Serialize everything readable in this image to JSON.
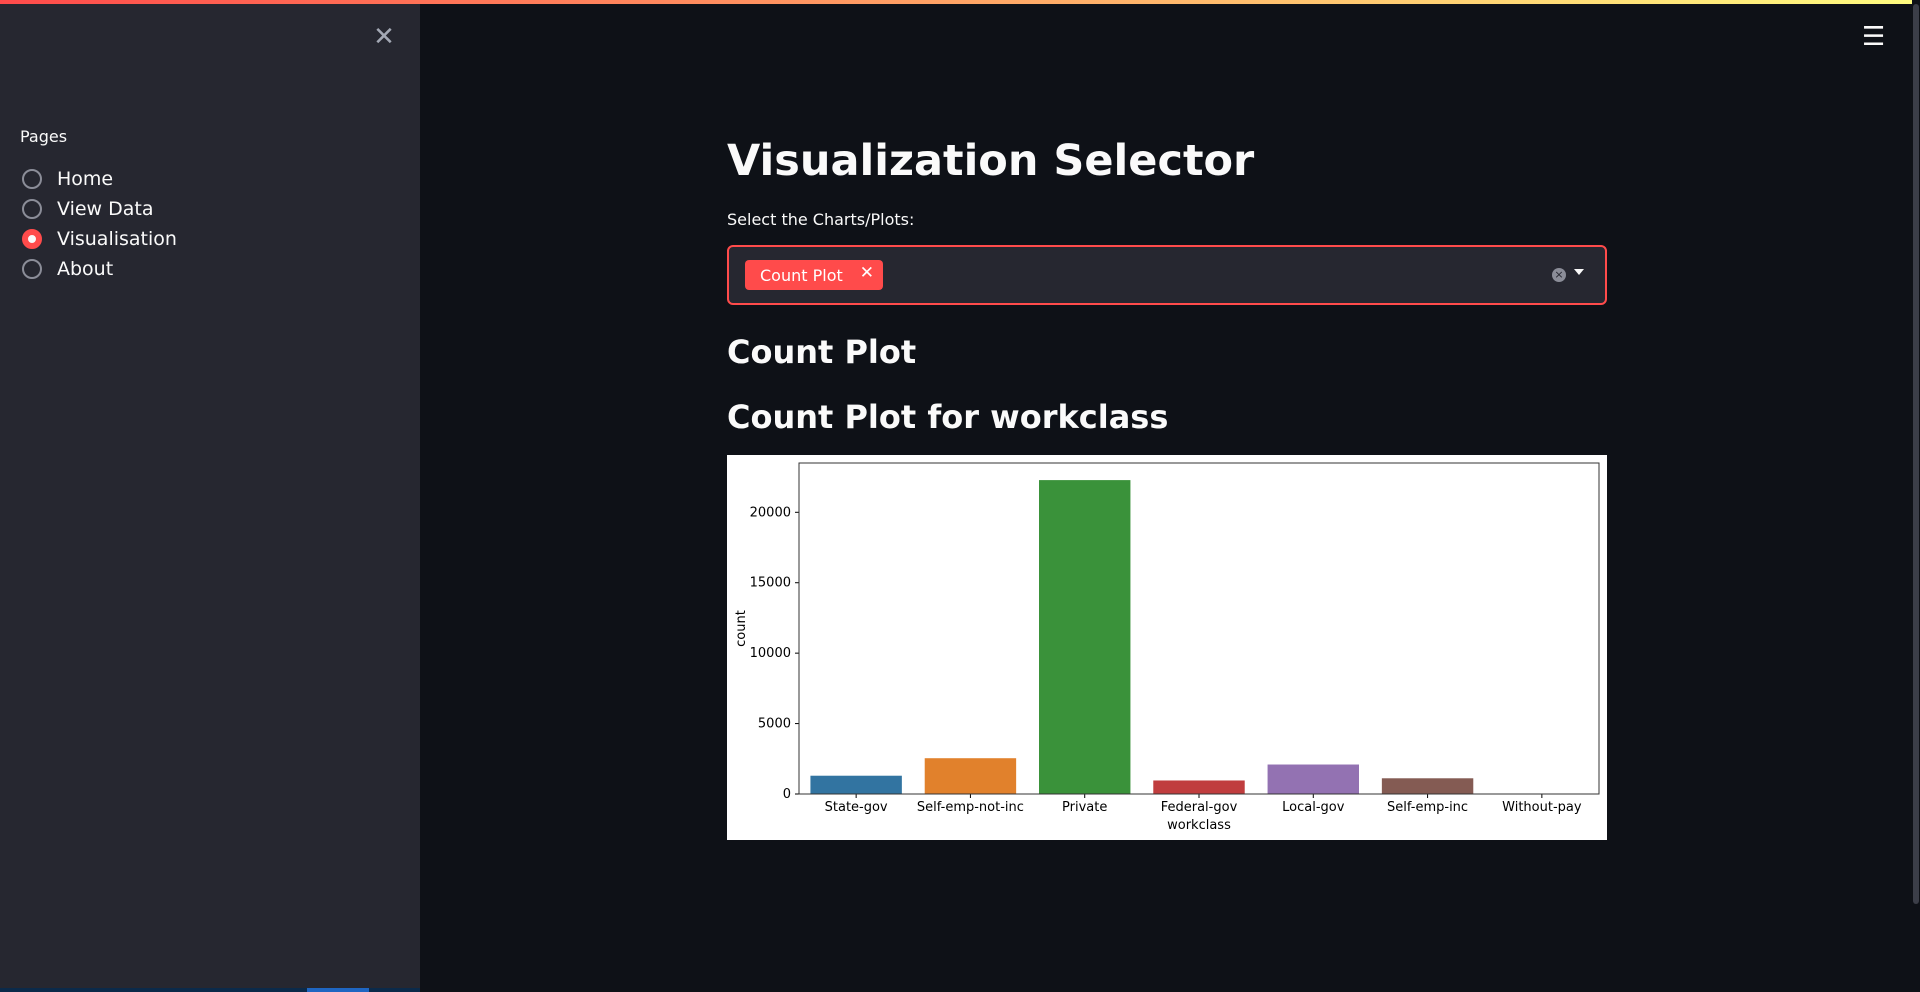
{
  "sidebar": {
    "close_icon": "close-icon",
    "pages_label": "Pages",
    "items": [
      {
        "label": "Home",
        "selected": false
      },
      {
        "label": "View Data",
        "selected": false
      },
      {
        "label": "Visualisation",
        "selected": true
      },
      {
        "label": "About",
        "selected": false
      }
    ]
  },
  "header": {
    "menu_icon": "hamburger-icon",
    "menu_glyph": "☰"
  },
  "main": {
    "title": "Visualization Selector",
    "select_label": "Select the Charts/Plots:",
    "selected_tags": [
      {
        "label": "Count Plot",
        "remove_glyph": "✕"
      }
    ],
    "clear_glyph": "×",
    "section_title": "Count Plot",
    "chart_title": "Count Plot for workclass"
  },
  "colors": {
    "accent": "#ff4b4b",
    "background": "#0e1117",
    "sidebar": "#262730"
  },
  "chart_data": {
    "type": "bar",
    "categories": [
      "State-gov",
      "Self-emp-not-inc",
      "Private",
      "Federal-gov",
      "Local-gov",
      "Self-emp-inc",
      "Without-pay"
    ],
    "values": [
      1298,
      2541,
      22286,
      960,
      2093,
      1116,
      14
    ],
    "colors": [
      "#3274a1",
      "#e1812c",
      "#3a923a",
      "#c03d3e",
      "#9372b2",
      "#845b53",
      "#d684bd"
    ],
    "xlabel": "workclass",
    "ylabel": "count",
    "ylim": [
      0,
      23500
    ],
    "yticks": [
      0,
      5000,
      10000,
      15000,
      20000
    ],
    "grid": false
  }
}
